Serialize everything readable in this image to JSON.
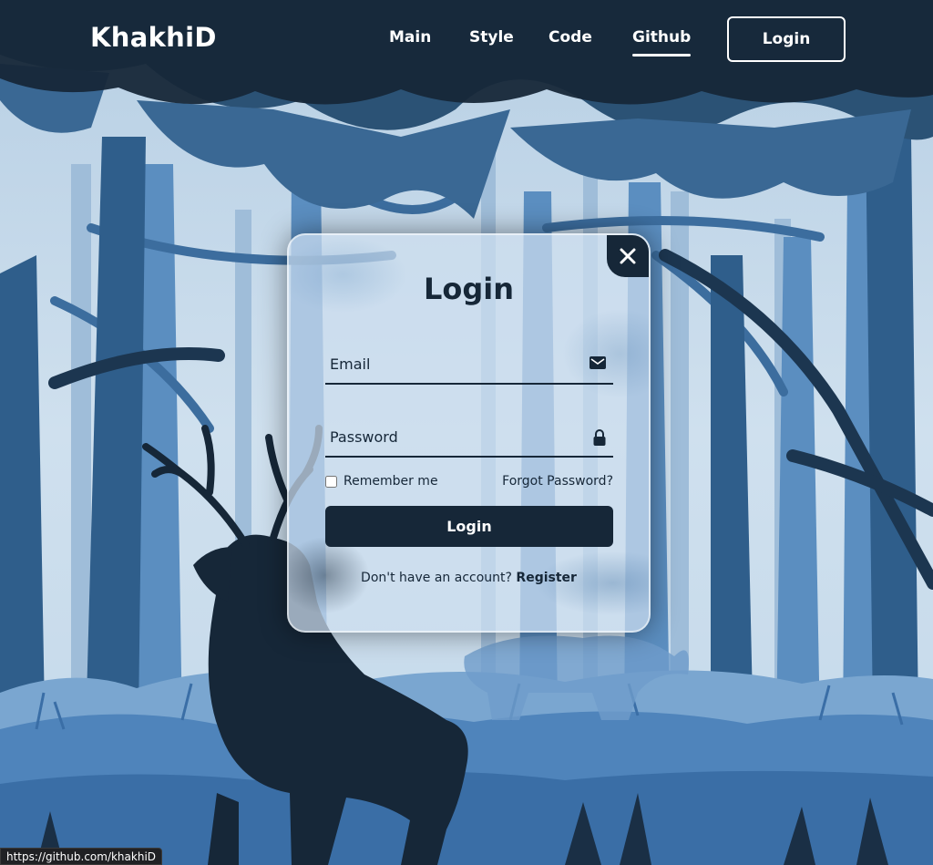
{
  "header": {
    "logo": "KhakhiD",
    "nav": [
      {
        "label": "Main",
        "active": false
      },
      {
        "label": "Style",
        "active": false
      },
      {
        "label": "Code",
        "active": false
      },
      {
        "label": "Github",
        "active": true
      }
    ],
    "login_button": "Login"
  },
  "login_form": {
    "title": "Login",
    "email_placeholder": "Email",
    "email_value": "",
    "password_placeholder": "Password",
    "password_value": "",
    "remember_label": "Remember me",
    "remember_checked": false,
    "forgot_label": "Forgot Password?",
    "submit_label": "Login",
    "register_prompt": "Don't have an account?",
    "register_link": "Register",
    "close_icon": "close-icon",
    "email_icon": "mail-icon",
    "password_icon": "lock-icon"
  },
  "status_bar": {
    "url": "https://github.com/khakhiD"
  },
  "colors": {
    "navy": "#162738",
    "sky": "#c9dcec",
    "mid_blue": "#4a7fb5",
    "deep_blue": "#2d5a86"
  }
}
